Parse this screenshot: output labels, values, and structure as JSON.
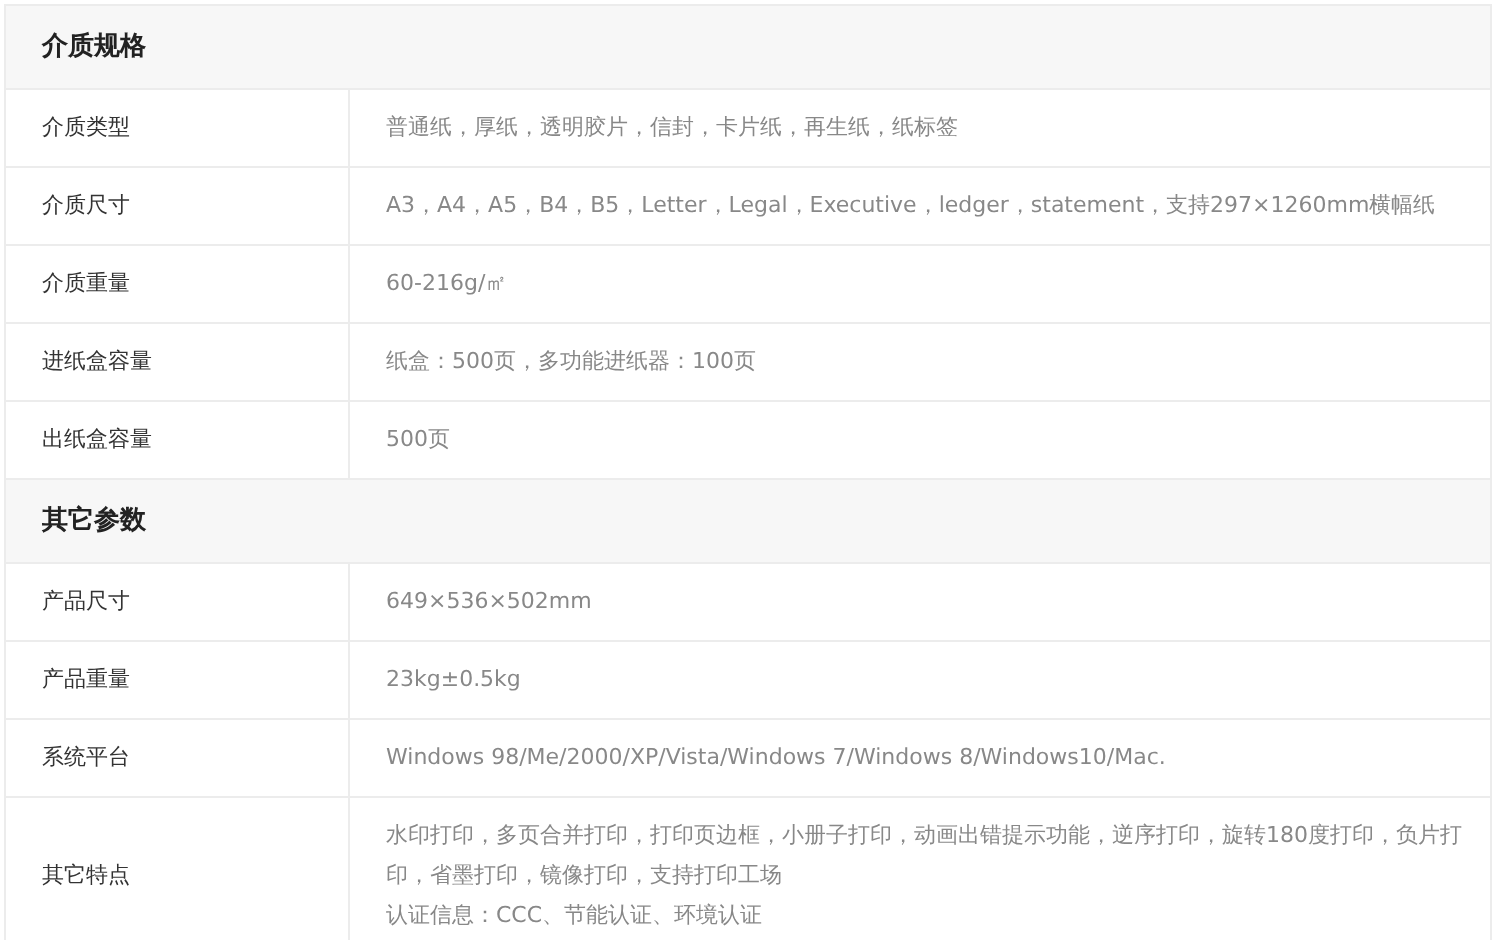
{
  "sections": [
    {
      "title": "介质规格",
      "rows": [
        {
          "label": "介质类型",
          "lines": [
            "普通纸，厚纸，透明胶片，信封，卡片纸，再生纸，纸标签"
          ]
        },
        {
          "label": "介质尺寸",
          "lines": [
            "A3，A4，A5，B4，B5，Letter，Legal，Executive，ledger，statement，支持297×1260mm横幅纸"
          ]
        },
        {
          "label": "介质重量",
          "lines": [
            "60-216g/㎡"
          ]
        },
        {
          "label": "进纸盒容量",
          "lines": [
            "纸盒：500页，多功能进纸器：100页"
          ]
        },
        {
          "label": "出纸盒容量",
          "lines": [
            "500页"
          ]
        }
      ]
    },
    {
      "title": "其它参数",
      "rows": [
        {
          "label": "产品尺寸",
          "lines": [
            "649×536×502mm"
          ]
        },
        {
          "label": "产品重量",
          "lines": [
            "23kg±0.5kg"
          ]
        },
        {
          "label": "系统平台",
          "lines": [
            "Windows 98/Me/2000/XP/Vista/Windows 7/Windows 8/Windows10/Mac."
          ]
        },
        {
          "label": "其它特点",
          "lines": [
            "水印打印，多页合并打印，打印页边框，小册子打印，动画出错提示功能，逆序打印，旋转180度打印，负片打印，省墨打印，镜像打印，支持打印工场",
            "认证信息：CCC、节能认证、环境认证"
          ]
        }
      ]
    }
  ]
}
